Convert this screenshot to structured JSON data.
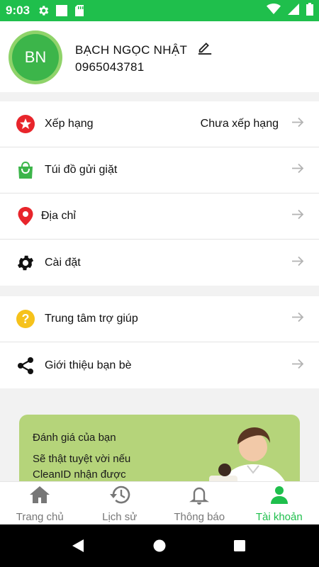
{
  "status_bar": {
    "time": "9:03"
  },
  "profile": {
    "initials": "BN",
    "name": "BẠCH NGỌC NHẬT",
    "phone": "0965043781"
  },
  "menu": {
    "ranking": {
      "label": "Xếp hạng",
      "value": "Chưa xếp hạng"
    },
    "bag": {
      "label": "Túi đồ gửi giặt"
    },
    "address": {
      "label": "Địa chỉ"
    },
    "settings": {
      "label": "Cài đặt"
    },
    "help": {
      "label": "Trung tâm trợ giúp"
    },
    "refer": {
      "label": "Giới thiệu bạn bè"
    }
  },
  "promo": {
    "title": "Đánh giá của bạn",
    "text": "Sẽ thật tuyệt vời nếu CleanID nhận được"
  },
  "bottom_nav": {
    "home": "Trang chủ",
    "history": "Lịch sử",
    "notifications": "Thông báo",
    "account": "Tài khoản"
  },
  "colors": {
    "brand": "#1fbf4c",
    "avatar": "#3cb54a",
    "promo_bg": "#b5d47a",
    "rank_icon": "#e8252b",
    "help_icon": "#f6c21b"
  }
}
